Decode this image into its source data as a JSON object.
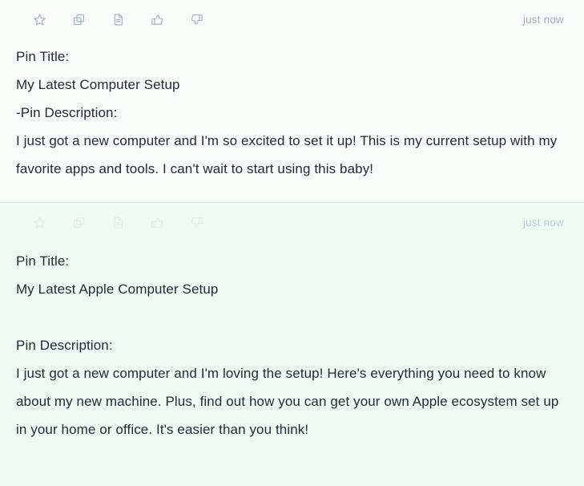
{
  "app": {
    "type": "chat-conversation",
    "background_top": "#f8fdfa",
    "background_bottom": "#eefbf2",
    "text_color": "#232b3a",
    "icon_color_active": "#a8b2c8",
    "icon_color_faded": "#e2efe6"
  },
  "toolbar_icons": [
    {
      "name": "star-icon",
      "label": "Favorite"
    },
    {
      "name": "copy-icon",
      "label": "Copy"
    },
    {
      "name": "document-icon",
      "label": "Document"
    },
    {
      "name": "thumbs-up-icon",
      "label": "Good response"
    },
    {
      "name": "thumbs-down-icon",
      "label": "Bad response"
    }
  ],
  "messages": [
    {
      "timestamp": "just now",
      "lines": [
        {
          "text": "Pin Title:",
          "gap_after": false
        },
        {
          "text": "My Latest Computer Setup",
          "gap_after": false
        },
        {
          "text": "-Pin Description:",
          "gap_after": false
        },
        {
          "text": "I just got a new computer and I'm so excited to set it up! This is my current setup with my favorite apps and tools. I can't wait to start using this baby!",
          "gap_after": false
        }
      ]
    },
    {
      "timestamp": "just now",
      "lines": [
        {
          "text": "Pin Title:",
          "gap_after": false
        },
        {
          "text": "My Latest Apple Computer Setup",
          "gap_after": true
        },
        {
          "text": "Pin Description:",
          "gap_after": false
        },
        {
          "text": "I just got a new computer and I'm loving the setup! Here's everything you need to know about my new machine. Plus, find out how you can get your own Apple ecosystem set up in your home or office. It's easier than you think!",
          "gap_after": false
        }
      ]
    }
  ]
}
